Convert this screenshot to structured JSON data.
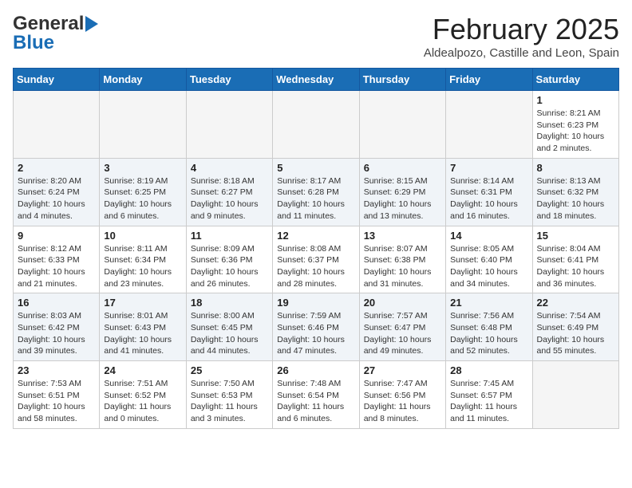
{
  "header": {
    "logo_line1": "General",
    "logo_line2": "Blue",
    "month": "February 2025",
    "location": "Aldealpozo, Castille and Leon, Spain"
  },
  "weekdays": [
    "Sunday",
    "Monday",
    "Tuesday",
    "Wednesday",
    "Thursday",
    "Friday",
    "Saturday"
  ],
  "weeks": [
    [
      {
        "day": "",
        "info": ""
      },
      {
        "day": "",
        "info": ""
      },
      {
        "day": "",
        "info": ""
      },
      {
        "day": "",
        "info": ""
      },
      {
        "day": "",
        "info": ""
      },
      {
        "day": "",
        "info": ""
      },
      {
        "day": "1",
        "info": "Sunrise: 8:21 AM\nSunset: 6:23 PM\nDaylight: 10 hours and 2 minutes."
      }
    ],
    [
      {
        "day": "2",
        "info": "Sunrise: 8:20 AM\nSunset: 6:24 PM\nDaylight: 10 hours and 4 minutes."
      },
      {
        "day": "3",
        "info": "Sunrise: 8:19 AM\nSunset: 6:25 PM\nDaylight: 10 hours and 6 minutes."
      },
      {
        "day": "4",
        "info": "Sunrise: 8:18 AM\nSunset: 6:27 PM\nDaylight: 10 hours and 9 minutes."
      },
      {
        "day": "5",
        "info": "Sunrise: 8:17 AM\nSunset: 6:28 PM\nDaylight: 10 hours and 11 minutes."
      },
      {
        "day": "6",
        "info": "Sunrise: 8:15 AM\nSunset: 6:29 PM\nDaylight: 10 hours and 13 minutes."
      },
      {
        "day": "7",
        "info": "Sunrise: 8:14 AM\nSunset: 6:31 PM\nDaylight: 10 hours and 16 minutes."
      },
      {
        "day": "8",
        "info": "Sunrise: 8:13 AM\nSunset: 6:32 PM\nDaylight: 10 hours and 18 minutes."
      }
    ],
    [
      {
        "day": "9",
        "info": "Sunrise: 8:12 AM\nSunset: 6:33 PM\nDaylight: 10 hours and 21 minutes."
      },
      {
        "day": "10",
        "info": "Sunrise: 8:11 AM\nSunset: 6:34 PM\nDaylight: 10 hours and 23 minutes."
      },
      {
        "day": "11",
        "info": "Sunrise: 8:09 AM\nSunset: 6:36 PM\nDaylight: 10 hours and 26 minutes."
      },
      {
        "day": "12",
        "info": "Sunrise: 8:08 AM\nSunset: 6:37 PM\nDaylight: 10 hours and 28 minutes."
      },
      {
        "day": "13",
        "info": "Sunrise: 8:07 AM\nSunset: 6:38 PM\nDaylight: 10 hours and 31 minutes."
      },
      {
        "day": "14",
        "info": "Sunrise: 8:05 AM\nSunset: 6:40 PM\nDaylight: 10 hours and 34 minutes."
      },
      {
        "day": "15",
        "info": "Sunrise: 8:04 AM\nSunset: 6:41 PM\nDaylight: 10 hours and 36 minutes."
      }
    ],
    [
      {
        "day": "16",
        "info": "Sunrise: 8:03 AM\nSunset: 6:42 PM\nDaylight: 10 hours and 39 minutes."
      },
      {
        "day": "17",
        "info": "Sunrise: 8:01 AM\nSunset: 6:43 PM\nDaylight: 10 hours and 41 minutes."
      },
      {
        "day": "18",
        "info": "Sunrise: 8:00 AM\nSunset: 6:45 PM\nDaylight: 10 hours and 44 minutes."
      },
      {
        "day": "19",
        "info": "Sunrise: 7:59 AM\nSunset: 6:46 PM\nDaylight: 10 hours and 47 minutes."
      },
      {
        "day": "20",
        "info": "Sunrise: 7:57 AM\nSunset: 6:47 PM\nDaylight: 10 hours and 49 minutes."
      },
      {
        "day": "21",
        "info": "Sunrise: 7:56 AM\nSunset: 6:48 PM\nDaylight: 10 hours and 52 minutes."
      },
      {
        "day": "22",
        "info": "Sunrise: 7:54 AM\nSunset: 6:49 PM\nDaylight: 10 hours and 55 minutes."
      }
    ],
    [
      {
        "day": "23",
        "info": "Sunrise: 7:53 AM\nSunset: 6:51 PM\nDaylight: 10 hours and 58 minutes."
      },
      {
        "day": "24",
        "info": "Sunrise: 7:51 AM\nSunset: 6:52 PM\nDaylight: 11 hours and 0 minutes."
      },
      {
        "day": "25",
        "info": "Sunrise: 7:50 AM\nSunset: 6:53 PM\nDaylight: 11 hours and 3 minutes."
      },
      {
        "day": "26",
        "info": "Sunrise: 7:48 AM\nSunset: 6:54 PM\nDaylight: 11 hours and 6 minutes."
      },
      {
        "day": "27",
        "info": "Sunrise: 7:47 AM\nSunset: 6:56 PM\nDaylight: 11 hours and 8 minutes."
      },
      {
        "day": "28",
        "info": "Sunrise: 7:45 AM\nSunset: 6:57 PM\nDaylight: 11 hours and 11 minutes."
      },
      {
        "day": "",
        "info": ""
      }
    ]
  ]
}
